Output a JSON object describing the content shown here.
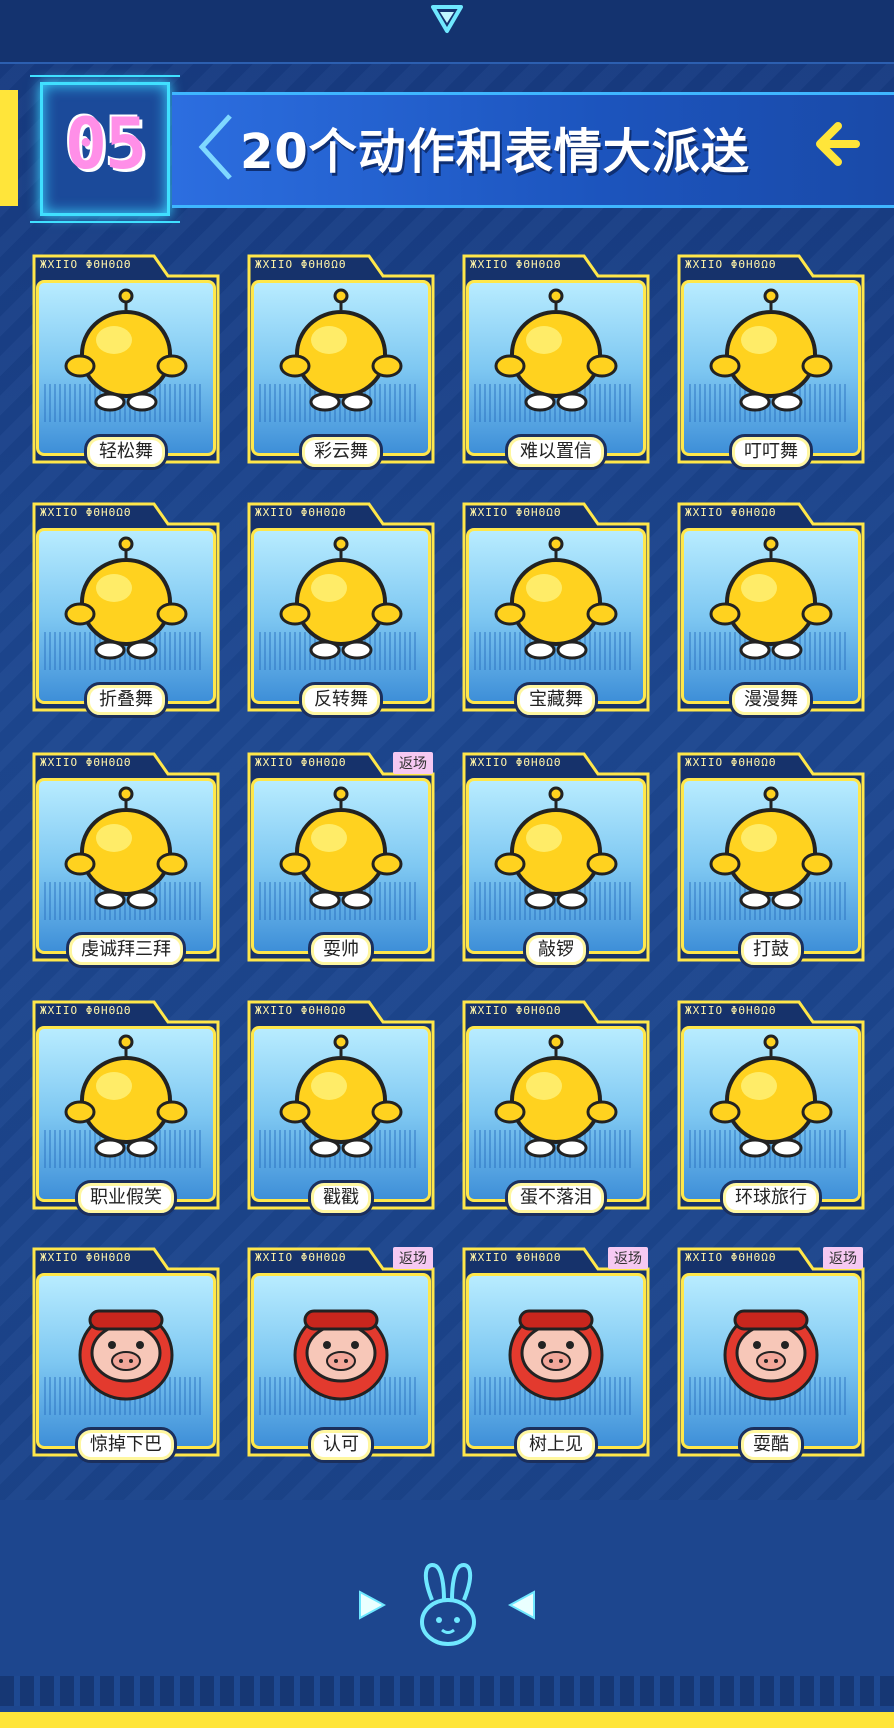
{
  "header": {
    "number": "05",
    "title": "20个动作和表情大派送"
  },
  "card_tab_code": "ЖXIIO ΦΘΗΘΩΘ",
  "return_badge": "返场",
  "colors": {
    "accent_yellow": "#ffe53a",
    "number_pink": "#ff8fe8",
    "background": "#1a3f86",
    "card_border": "#ffe74a"
  },
  "cards": [
    {
      "label": "轻松舞",
      "art": "yellow-mascot-icon",
      "returned": false
    },
    {
      "label": "彩云舞",
      "art": "yellow-mascot-icon",
      "returned": false
    },
    {
      "label": "难以置信",
      "art": "yellow-mascot-icon",
      "returned": false
    },
    {
      "label": "叮叮舞",
      "art": "yellow-mascot-icon",
      "returned": false
    },
    {
      "label": "折叠舞",
      "art": "yellow-mascot-icon",
      "returned": false
    },
    {
      "label": "反转舞",
      "art": "yellow-mascot-icon",
      "returned": false
    },
    {
      "label": "宝藏舞",
      "art": "yellow-mascot-icon",
      "returned": false
    },
    {
      "label": "漫漫舞",
      "art": "yellow-mascot-icon",
      "returned": false
    },
    {
      "label": "虔诚拜三拜",
      "art": "yellow-mascot-icon",
      "returned": false
    },
    {
      "label": "耍帅",
      "art": "yellow-mascot-icon",
      "returned": true
    },
    {
      "label": "敲锣",
      "art": "yellow-mascot-gong-icon",
      "returned": false
    },
    {
      "label": "打鼓",
      "art": "yellow-mascot-drum-icon",
      "returned": false
    },
    {
      "label": "职业假笑",
      "art": "yellow-mascot-smile-icon",
      "returned": false
    },
    {
      "label": "戳戳",
      "art": "yellow-mascot-poke-icon",
      "returned": false
    },
    {
      "label": "蛋不落泪",
      "art": "yellow-mascot-tear-icon",
      "returned": false
    },
    {
      "label": "环球旅行",
      "art": "yellow-mascot-plane-icon",
      "returned": false
    },
    {
      "label": "惊掉下巴",
      "art": "pig-mascot-shock-icon",
      "returned": false
    },
    {
      "label": "认可",
      "art": "pig-mascot-thumbs-icon",
      "returned": true
    },
    {
      "label": "树上见",
      "art": "pig-mascot-tree-icon",
      "returned": true
    },
    {
      "label": "耍酷",
      "art": "pig-mascot-cool-icon",
      "returned": true
    }
  ]
}
